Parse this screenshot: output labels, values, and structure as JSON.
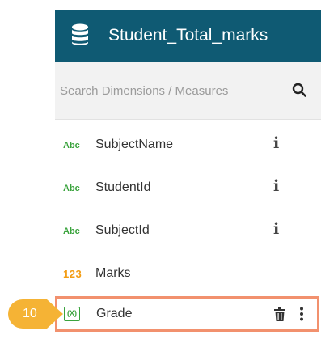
{
  "header": {
    "title": "Student_Total_marks",
    "icon": "database-icon",
    "background": "#0f5a73"
  },
  "search": {
    "placeholder": "Search Dimensions / Measures",
    "value": "",
    "icon": "search-icon"
  },
  "fields": [
    {
      "type_label": "Abc",
      "name": "SubjectName",
      "icon": "info-icon"
    },
    {
      "type_label": "Abc",
      "name": "StudentId",
      "icon": "info-icon"
    },
    {
      "type_label": "Abc",
      "name": "SubjectId",
      "icon": "info-icon"
    },
    {
      "type_label": "123",
      "name": "Marks"
    }
  ],
  "grade_field": {
    "type_label": "(X)",
    "name": "Grade",
    "actions": [
      "trash-icon",
      "more-vertical-icon"
    ],
    "highlight_color": "#f2916e"
  },
  "step_badge": {
    "number": "10",
    "color": "#f5b335"
  },
  "colors": {
    "dimension": "#3aa33d",
    "measure": "#f39c12"
  }
}
